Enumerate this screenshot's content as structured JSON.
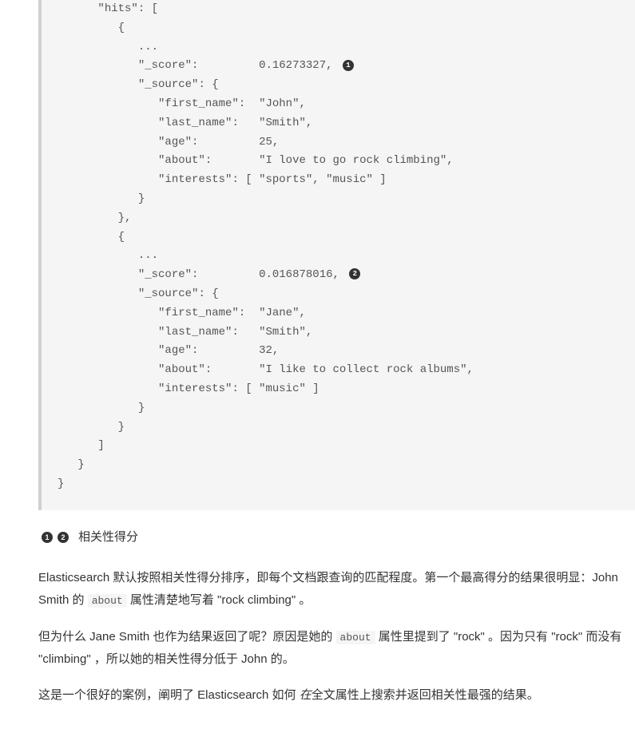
{
  "code": {
    "hits_key": "\"hits\": [",
    "dots": "...",
    "score_key": "\"_score\":",
    "score1": "0.16273327,",
    "score2": "0.016878016,",
    "source_key": "\"_source\": {",
    "first_name_key": "\"first_name\":",
    "last_name_key": "\"last_name\":",
    "age_key": "\"age\":",
    "about_key": "\"about\":",
    "interests_key": "\"interests\":",
    "john_first": "\"John\",",
    "john_last": "\"Smith\",",
    "john_age": "25,",
    "john_about": "\"I love to go rock climbing\",",
    "john_interests": "[ \"sports\", \"music\" ]",
    "jane_first": "\"Jane\",",
    "jane_last": "\"Smith\",",
    "jane_age": "32,",
    "jane_about": "\"I like to collect rock albums\",",
    "jane_interests": "[ \"music\" ]"
  },
  "callout": {
    "num1": "1",
    "num2": "2",
    "legend": "相关性得分"
  },
  "text": {
    "p1_a": "Elasticsearch 默认按照相关性得分排序，即每个文档跟查询的匹配程度。第一个最高得分的结果很明显：John Smith 的 ",
    "p1_code": "about",
    "p1_b": " 属性清楚地写着 \"rock climbing\" 。",
    "p2_a": "但为什么 Jane Smith 也作为结果返回了呢？原因是她的 ",
    "p2_code": "about",
    "p2_b": " 属性里提到了 \"rock\" 。因为只有 \"rock\" 而没有 \"climbing\" ，所以她的相关性得分低于 John 的。",
    "p3_a": "这是一个很好的案例，阐明了 Elasticsearch 如何 ",
    "p3_italic": "在",
    "p3_b": "全文属性上搜索并返回相关性最强的结果。"
  }
}
